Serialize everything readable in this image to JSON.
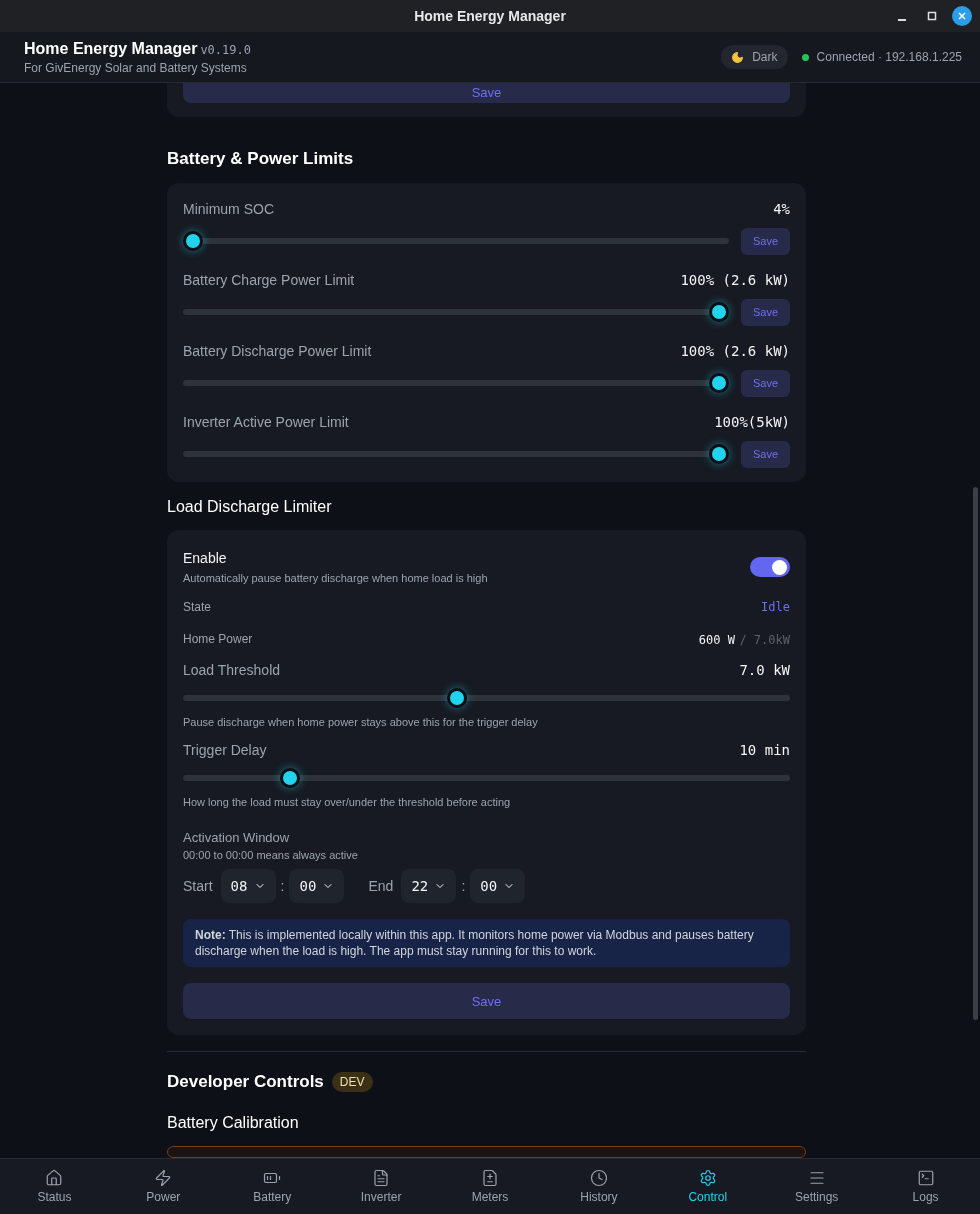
{
  "window": {
    "title": "Home Energy Manager"
  },
  "header": {
    "app_name": "Home Energy Manager",
    "version": "v0.19.0",
    "subtitle": "For GivEnergy Solar and Battery Systems",
    "theme_button": "Dark",
    "connection": {
      "status": "Connected · 192.168.1.225",
      "connected": true
    }
  },
  "previous_card": {
    "button": "Save"
  },
  "battery_limits": {
    "title": "Battery & Power Limits",
    "sliders": [
      {
        "label": "Minimum SOC",
        "value": "4%",
        "level": 0,
        "button": "Save"
      },
      {
        "label": "Battery Charge Power Limit",
        "value": "100% (2.6 kW)",
        "level": 1,
        "button": "Save"
      },
      {
        "label": "Battery Discharge Power Limit",
        "value": "100% (2.6 kW)",
        "level": 1,
        "button": "Save"
      },
      {
        "label": "Inverter Active Power Limit",
        "value": "100%(5kW)",
        "level": 1,
        "button": "Save"
      }
    ]
  },
  "load_discharge": {
    "title": "Load Discharge Limiter",
    "enable": {
      "label": "Enable",
      "description": "Automatically pause battery discharge when home load is high",
      "on": true
    },
    "state": {
      "label": "State",
      "value": "Idle"
    },
    "home_power": {
      "label": "Home Power",
      "value": "600 W",
      "limit": "/ 7.0kW"
    },
    "sliders": [
      {
        "label": "Load Threshold",
        "value": "7.0 kW",
        "level": 0.45,
        "hint": "Pause discharge when home power stays above this for the trigger delay"
      },
      {
        "label": "Trigger Delay",
        "value": "10 min",
        "level": 0.165,
        "hint": "How long the load must stay over/under the threshold before acting"
      }
    ],
    "activation_window": {
      "title": "Activation Window",
      "hint": "00:00 to 00:00 means always active",
      "times": [
        {
          "label": "Start",
          "hour": "08",
          "separator": ":",
          "minute": "00"
        },
        {
          "label": "End",
          "hour": "22",
          "separator": ":",
          "minute": "00"
        }
      ]
    },
    "note": "**Note:** This is implemented locally within this app. It monitors home power via Modbus and pauses battery discharge when the load is high. The app must stay running for this to work.",
    "button": "Save"
  },
  "developer": {
    "title": "Developer Controls",
    "badge": "DEV",
    "subsection": "Battery Calibration"
  },
  "nav": [
    {
      "label": "Status",
      "selected": false
    },
    {
      "label": "Power",
      "selected": false
    },
    {
      "label": "Battery",
      "selected": false
    },
    {
      "label": "Inverter",
      "selected": false
    },
    {
      "label": "Meters",
      "selected": false
    },
    {
      "label": "History",
      "selected": false
    },
    {
      "label": "Control",
      "selected": true
    },
    {
      "label": "Settings",
      "selected": false
    },
    {
      "label": "Logs",
      "selected": false
    }
  ]
}
